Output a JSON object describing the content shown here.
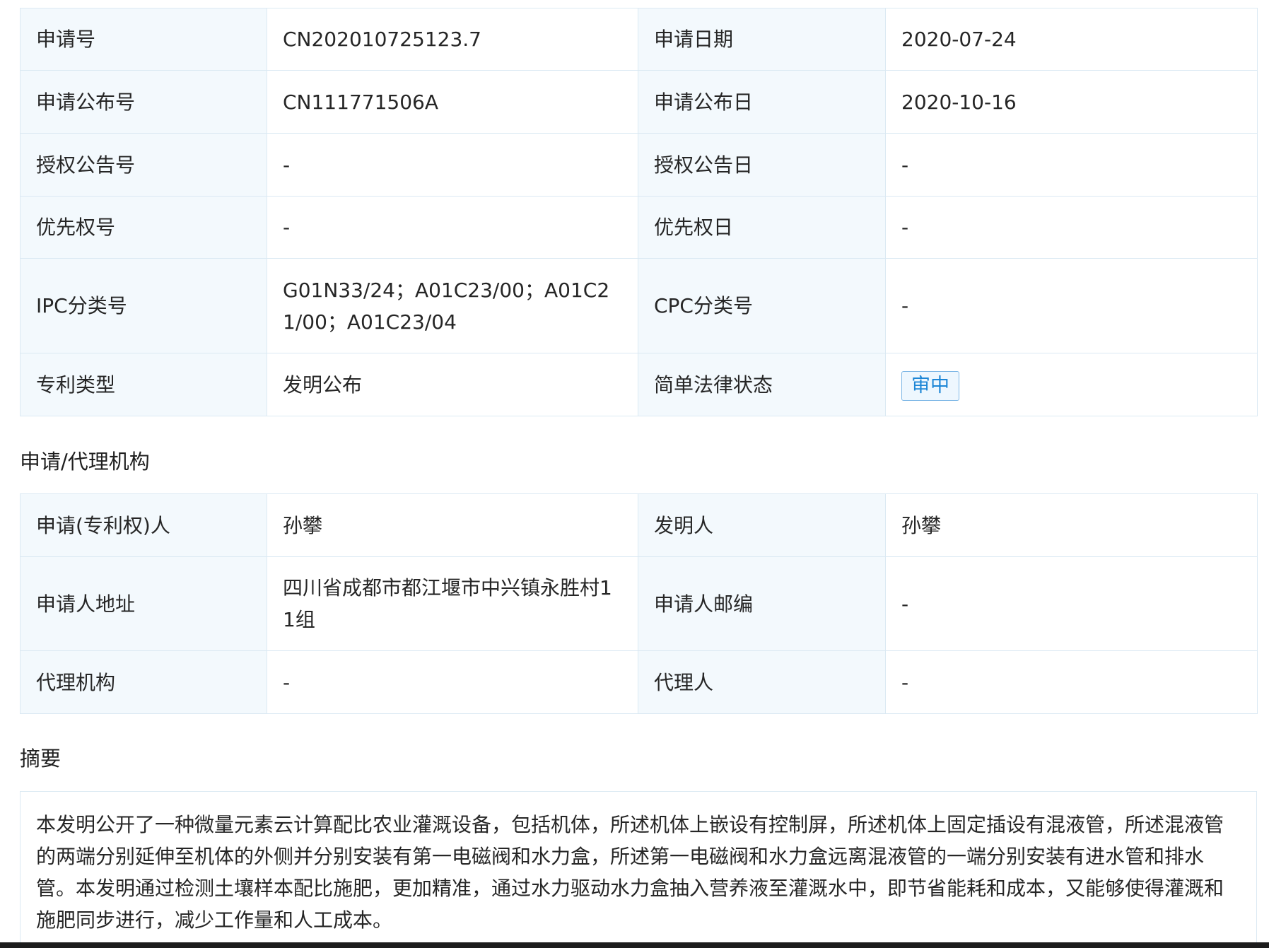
{
  "basic_info": {
    "rows": [
      {
        "k1": "申请号",
        "v1": "CN202010725123.7",
        "k2": "申请日期",
        "v2": "2020-07-24"
      },
      {
        "k1": "申请公布号",
        "v1": "CN111771506A",
        "k2": "申请公布日",
        "v2": "2020-10-16"
      },
      {
        "k1": "授权公告号",
        "v1": "-",
        "k2": "授权公告日",
        "v2": "-"
      },
      {
        "k1": "优先权号",
        "v1": "-",
        "k2": "优先权日",
        "v2": "-"
      },
      {
        "k1": "IPC分类号",
        "v1": "G01N33/24；A01C23/00；A01C21/00；A01C23/04",
        "k2": "CPC分类号",
        "v2": "-"
      },
      {
        "k1": "专利类型",
        "v1": "发明公布",
        "k2": "简单法律状态",
        "v2": "审中"
      }
    ]
  },
  "agency": {
    "title": "申请/代理机构",
    "rows": [
      {
        "k1": "申请(专利权)人",
        "v1": "孙攀",
        "k2": "发明人",
        "v2": "孙攀"
      },
      {
        "k1": "申请人地址",
        "v1": "四川省成都市都江堰市中兴镇永胜村11组",
        "k2": "申请人邮编",
        "v2": "-"
      },
      {
        "k1": "代理机构",
        "v1": "-",
        "k2": "代理人",
        "v2": "-"
      }
    ]
  },
  "abstract": {
    "title": "摘要",
    "text": "本发明公开了一种微量元素云计算配比农业灌溉设备，包括机体，所述机体上嵌设有控制屏，所述机体上固定插设有混液管，所述混液管的两端分别延伸至机体的外侧并分别安装有第一电磁阀和水力盒，所述第一电磁阀和水力盒远离混液管的一端分别安装有进水管和排水管。本发明通过检测土壤样本配比施肥，更加精准，通过水力驱动水力盒抽入营养液至灌溉水中，即节省能耗和成本，又能够使得灌溉和施肥同步进行，减少工作量和人工成本。"
  },
  "colors": {
    "key_cell_bg": "#f3f9fd",
    "border": "#dbe9f3",
    "status_badge_text": "#1d86d6",
    "status_badge_border": "#7fb8e6"
  }
}
